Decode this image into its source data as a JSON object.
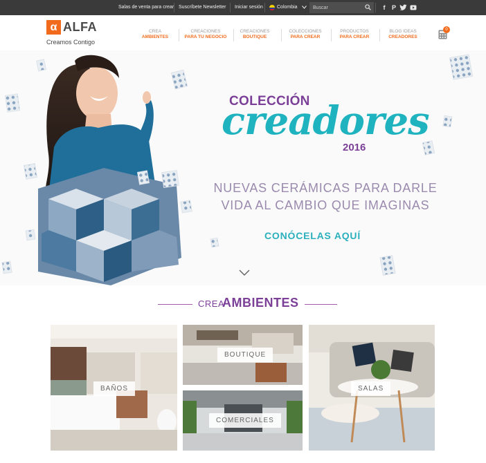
{
  "topbar": {
    "links": [
      "Salas de venta para crear",
      "Suscríbete Newsletter",
      "Iniciar sesión"
    ],
    "country": "Colombia",
    "search_placeholder": "Buscar",
    "social_icons": [
      "facebook-icon",
      "pinterest-icon",
      "twitter-icon",
      "youtube-icon"
    ]
  },
  "brand": {
    "name": "ALFA",
    "tagline": "Creamos Contigo",
    "color": "#f26b1d"
  },
  "nav": [
    {
      "line1": "CREA",
      "line2": "AMBIENTES"
    },
    {
      "line1": "CREACIONES",
      "line2": "PARA TU NEGOCIO"
    },
    {
      "line1": "CREACIONES",
      "line2": "BOUTIQUE"
    },
    {
      "line1": "COLECCIONES",
      "line2": "PARA CREAR"
    },
    {
      "line1": "PRODUCTOS",
      "line2": "PARA CREAR"
    },
    {
      "line1": "BLOG IDEAS",
      "line2": "CREADORES"
    }
  ],
  "cart": {
    "count": "0"
  },
  "hero": {
    "kicker": "COLECCIÓN",
    "title": "creadores",
    "year": "2016",
    "tagline_1": "NUEVAS CERÁMICAS PARA DARLE",
    "tagline_2": "VIDA AL CAMBIO QUE IMAGINAS",
    "cta": "CONÓCELAS AQUÍ"
  },
  "section": {
    "prefix": "CREA",
    "title": "AMBIENTES"
  },
  "tiles": [
    {
      "label": "BAÑOS"
    },
    {
      "label": "BOUTIQUE"
    },
    {
      "label": "COMERCIALES"
    },
    {
      "label": "SALAS"
    }
  ],
  "colors": {
    "purple": "#7b3f98",
    "teal": "#1fb3bf",
    "orange": "#f26b1d",
    "topbar": "#3a3a3a"
  }
}
